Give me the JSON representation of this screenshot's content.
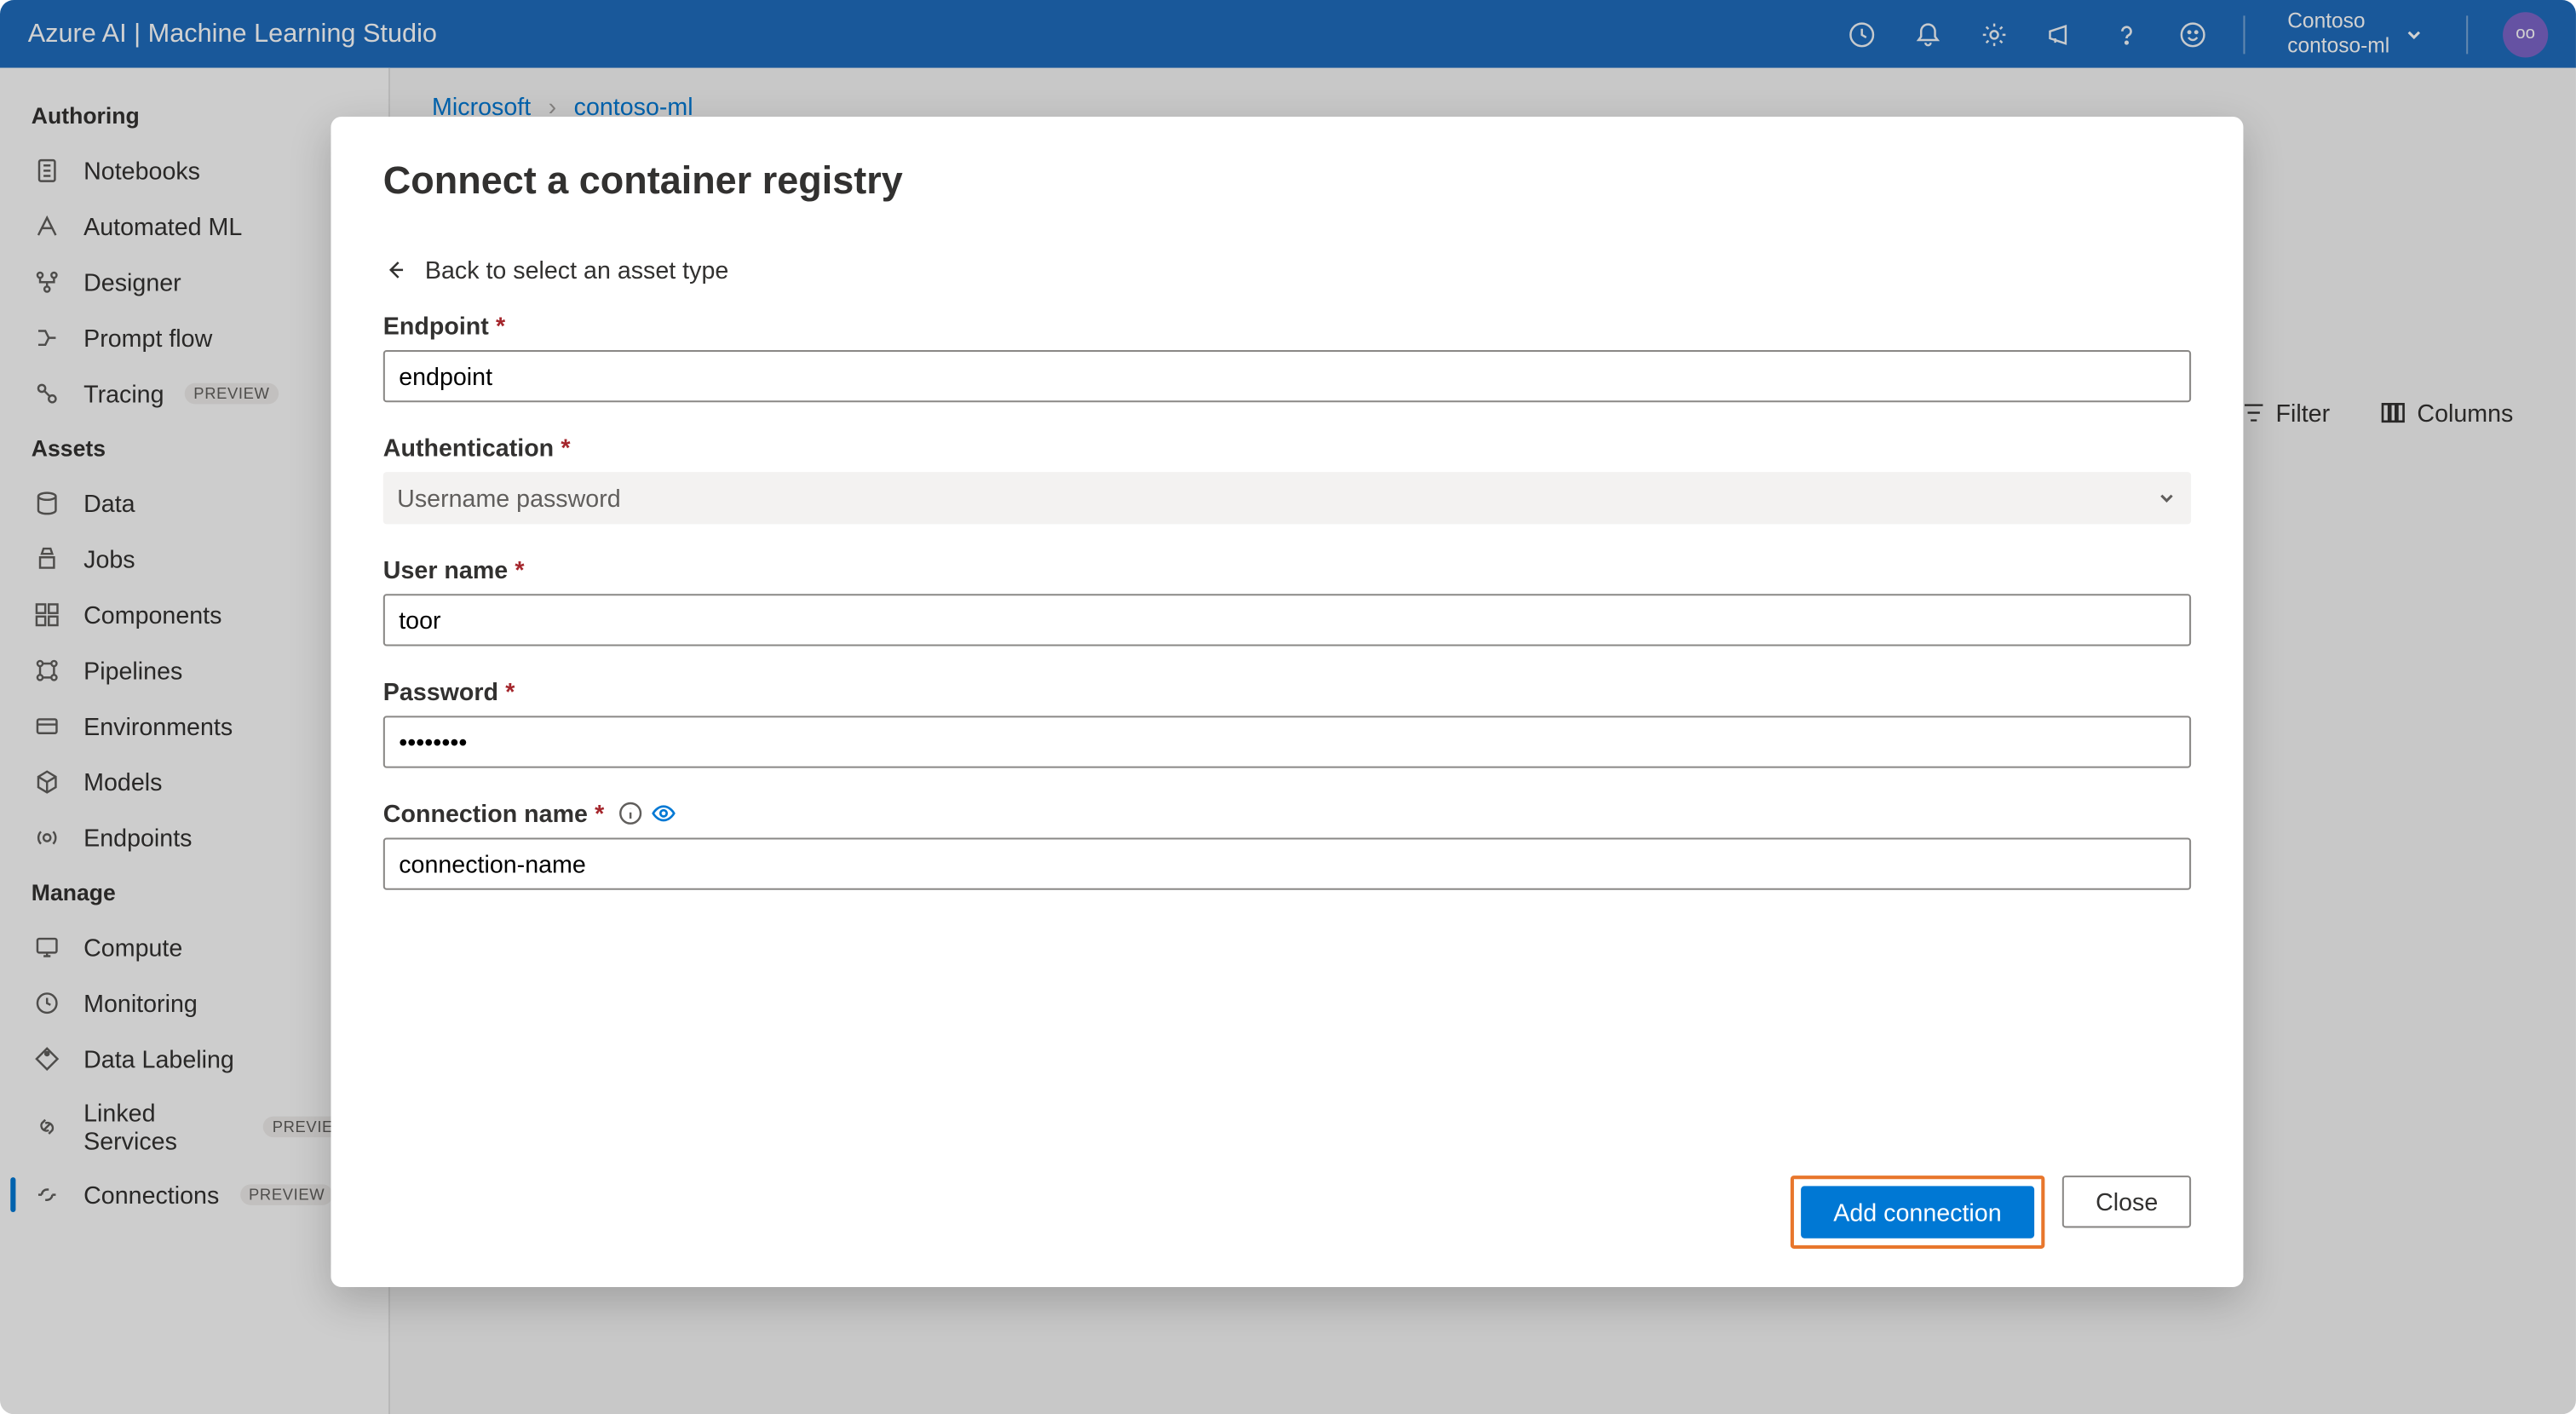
{
  "header": {
    "title": "Azure AI | Machine Learning Studio",
    "workspace_dir": "Contoso",
    "workspace_name": "contoso-ml",
    "avatar_initials": "oo"
  },
  "breadcrumb": {
    "items": [
      "Microsoft",
      "contoso-ml"
    ]
  },
  "toolbar": {
    "filter": "Filter",
    "columns": "Columns"
  },
  "sidebar": {
    "sections": [
      {
        "title": "Authoring",
        "items": [
          {
            "label": "Notebooks",
            "icon": "notebook-icon"
          },
          {
            "label": "Automated ML",
            "icon": "automl-icon"
          },
          {
            "label": "Designer",
            "icon": "designer-icon"
          },
          {
            "label": "Prompt flow",
            "icon": "promptflow-icon"
          },
          {
            "label": "Tracing",
            "icon": "tracing-icon",
            "preview": true
          }
        ]
      },
      {
        "title": "Assets",
        "items": [
          {
            "label": "Data",
            "icon": "data-icon"
          },
          {
            "label": "Jobs",
            "icon": "jobs-icon"
          },
          {
            "label": "Components",
            "icon": "components-icon"
          },
          {
            "label": "Pipelines",
            "icon": "pipelines-icon"
          },
          {
            "label": "Environments",
            "icon": "environments-icon"
          },
          {
            "label": "Models",
            "icon": "models-icon"
          },
          {
            "label": "Endpoints",
            "icon": "endpoints-icon"
          }
        ]
      },
      {
        "title": "Manage",
        "items": [
          {
            "label": "Compute",
            "icon": "compute-icon"
          },
          {
            "label": "Monitoring",
            "icon": "monitoring-icon"
          },
          {
            "label": "Data Labeling",
            "icon": "datalabeling-icon"
          },
          {
            "label": "Linked Services",
            "icon": "linked-icon",
            "preview": true
          },
          {
            "label": "Connections",
            "icon": "connections-icon",
            "preview": true,
            "active": true
          }
        ]
      }
    ],
    "preview_label": "PREVIEW"
  },
  "modal": {
    "title": "Connect a container registry",
    "back_link": "Back to select an asset type",
    "fields": {
      "endpoint_label": "Endpoint",
      "endpoint_value": "endpoint",
      "auth_label": "Authentication",
      "auth_value": "Username password",
      "username_label": "User name",
      "username_value": "toor",
      "password_label": "Password",
      "password_value": "••••••••",
      "connection_label": "Connection name",
      "connection_value": "connection-name"
    },
    "buttons": {
      "primary": "Add connection",
      "close": "Close"
    }
  }
}
